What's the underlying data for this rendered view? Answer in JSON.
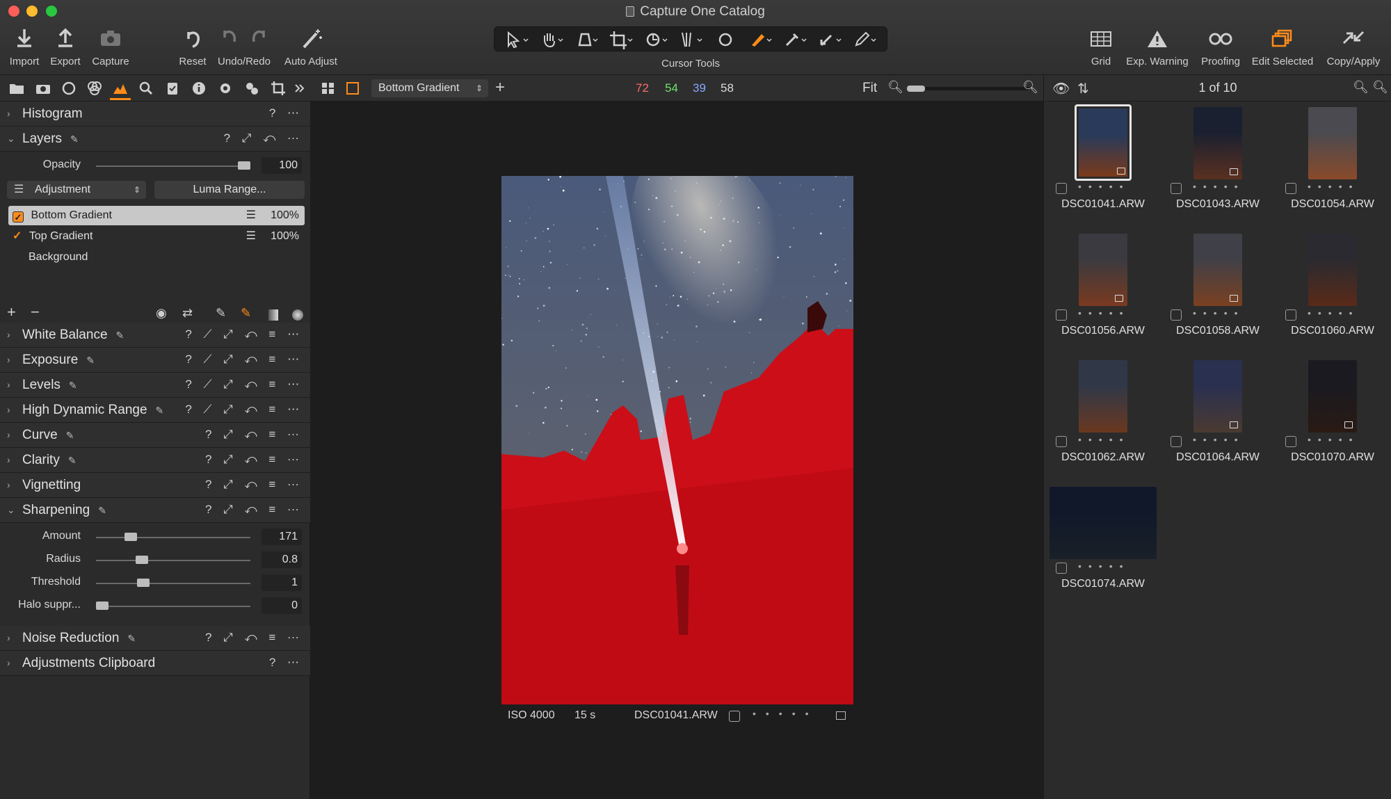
{
  "window": {
    "title": "Capture One Catalog"
  },
  "toolbar": {
    "import": "Import",
    "export": "Export",
    "capture": "Capture",
    "reset": "Reset",
    "undo_redo": "Undo/Redo",
    "auto_adjust": "Auto Adjust",
    "cursor_tools": "Cursor Tools",
    "grid": "Grid",
    "exp_warning": "Exp. Warning",
    "proofing": "Proofing",
    "edit_selected": "Edit Selected",
    "copy_apply": "Copy/Apply"
  },
  "layers": {
    "title": "Layers",
    "opacity_label": "Opacity",
    "opacity_value": "100",
    "opacity_level": 1.0,
    "type_select": "Adjustment",
    "luma_button": "Luma Range...",
    "items": [
      {
        "name": "Bottom Gradient",
        "opacity": "100%",
        "checked": true,
        "selected": true
      },
      {
        "name": "Top Gradient",
        "opacity": "100%",
        "checked": true,
        "selected": false
      },
      {
        "name": "Background",
        "opacity": "",
        "checked": false,
        "selected": false
      }
    ]
  },
  "sections": {
    "histogram": "Histogram",
    "white_balance": "White Balance",
    "exposure": "Exposure",
    "levels": "Levels",
    "hdr": "High Dynamic Range",
    "curve": "Curve",
    "clarity": "Clarity",
    "vignetting": "Vignetting",
    "sharpening": "Sharpening",
    "noise_reduction": "Noise Reduction",
    "clipboard": "Adjustments Clipboard"
  },
  "sharpening": {
    "amount": {
      "label": "Amount",
      "value": "171",
      "level": 0.2
    },
    "radius": {
      "label": "Radius",
      "value": "0.8",
      "level": 0.28
    },
    "threshold": {
      "label": "Threshold",
      "value": "1",
      "level": 0.29
    },
    "halo": {
      "label": "Halo suppr...",
      "value": "0",
      "level": 0.0
    }
  },
  "viewer": {
    "layer_select": "Bottom Gradient",
    "rgb": {
      "r": "72",
      "g": "54",
      "b": "39",
      "l": "58"
    },
    "zoom": "Fit",
    "iso": "ISO 4000",
    "shutter": "15 s",
    "filename": "DSC01041.ARW"
  },
  "browser": {
    "count": "1 of 10",
    "thumbs": [
      {
        "name": "DSC01041.ARW",
        "selected": true
      },
      {
        "name": "DSC01043.ARW",
        "selected": false
      },
      {
        "name": "DSC01054.ARW",
        "selected": false
      },
      {
        "name": "DSC01056.ARW",
        "selected": false
      },
      {
        "name": "DSC01058.ARW",
        "selected": false
      },
      {
        "name": "DSC01060.ARW",
        "selected": false
      },
      {
        "name": "DSC01062.ARW",
        "selected": false
      },
      {
        "name": "DSC01064.ARW",
        "selected": false
      },
      {
        "name": "DSC01070.ARW",
        "selected": false
      },
      {
        "name": "DSC01074.ARW",
        "selected": false
      }
    ]
  },
  "colors": {
    "accent": "#ff8c1a",
    "mask_red": "#d0101a",
    "panel": "#2b2b2b",
    "viewer_bg": "#1d1d1d"
  }
}
